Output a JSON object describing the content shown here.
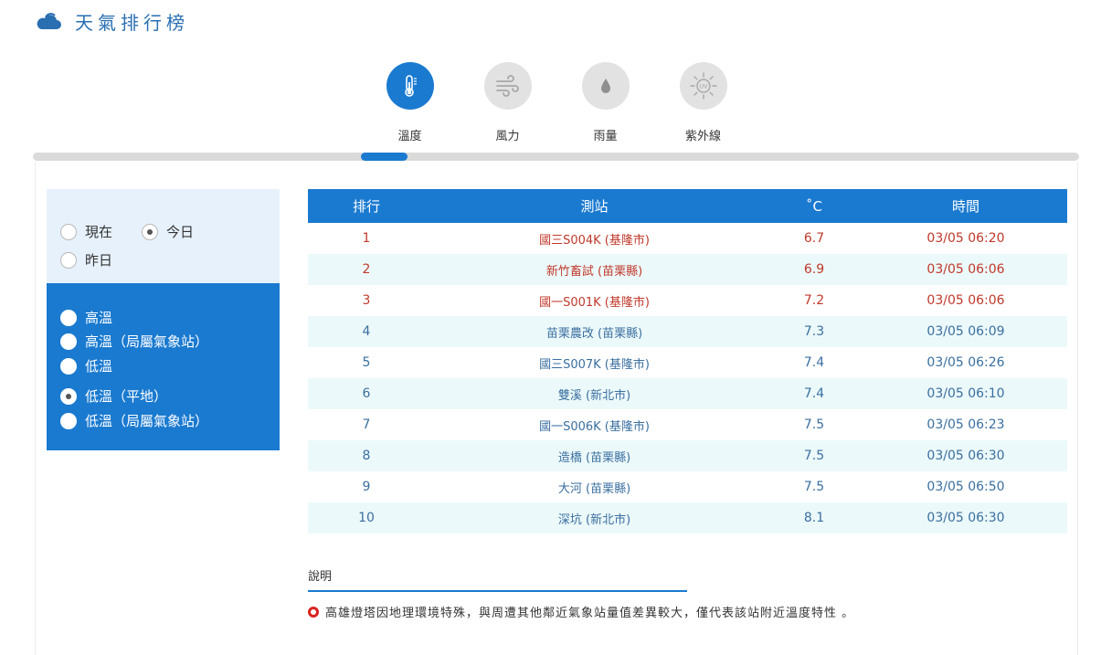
{
  "header": {
    "title": "天氣排行榜",
    "icon": "cloud-icon"
  },
  "tabs": [
    {
      "label": "溫度",
      "icon": "thermometer-icon",
      "active": true
    },
    {
      "label": "風力",
      "icon": "wind-icon",
      "active": false
    },
    {
      "label": "雨量",
      "icon": "raindrop-icon",
      "active": false
    },
    {
      "label": "紫外線",
      "icon": "uv-sun-icon",
      "active": false
    }
  ],
  "time_filter": {
    "options": [
      {
        "label": "現在",
        "checked": false
      },
      {
        "label": "今日",
        "checked": true
      },
      {
        "label": "昨日",
        "checked": false
      }
    ]
  },
  "type_filter": {
    "options": [
      {
        "label": "高溫",
        "checked": false
      },
      {
        "label": "高溫（局屬氣象站）",
        "checked": false
      },
      {
        "label": "低溫",
        "checked": false
      },
      {
        "label": "低溫（平地）",
        "checked": true
      },
      {
        "label": "低溫（局屬氣象站）",
        "checked": false
      }
    ]
  },
  "table": {
    "headers": {
      "rank": "排行",
      "station": "測站",
      "temp": "˚C",
      "time": "時間"
    },
    "rows": [
      {
        "rank": "1",
        "station": "國三S004K (基隆市)",
        "temp": "6.7",
        "time": "03/05 06:20",
        "highlight": true
      },
      {
        "rank": "2",
        "station": "新竹畜試 (苗栗縣)",
        "temp": "6.9",
        "time": "03/05 06:06",
        "highlight": true
      },
      {
        "rank": "3",
        "station": "國一S001K (基隆市)",
        "temp": "7.2",
        "time": "03/05 06:06",
        "highlight": true
      },
      {
        "rank": "4",
        "station": "苗栗農改 (苗栗縣)",
        "temp": "7.3",
        "time": "03/05 06:09",
        "highlight": false
      },
      {
        "rank": "5",
        "station": "國三S007K (基隆市)",
        "temp": "7.4",
        "time": "03/05 06:26",
        "highlight": false
      },
      {
        "rank": "6",
        "station": "雙溪 (新北市)",
        "temp": "7.4",
        "time": "03/05 06:10",
        "highlight": false
      },
      {
        "rank": "7",
        "station": "國一S006K (基隆市)",
        "temp": "7.5",
        "time": "03/05 06:23",
        "highlight": false
      },
      {
        "rank": "8",
        "station": "造橋 (苗栗縣)",
        "temp": "7.5",
        "time": "03/05 06:30",
        "highlight": false
      },
      {
        "rank": "9",
        "station": "大河 (苗栗縣)",
        "temp": "7.5",
        "time": "03/05 06:50",
        "highlight": false
      },
      {
        "rank": "10",
        "station": "深坑 (新北市)",
        "temp": "8.1",
        "time": "03/05 06:30",
        "highlight": false
      }
    ]
  },
  "notes": {
    "title": "說明",
    "items": [
      "高雄燈塔因地理環境特殊，與周遭其他鄰近氣象站量值差異較大，僅代表該站附近溫度特性 。"
    ]
  },
  "colors": {
    "accent": "#1a7ad0",
    "highlight_text": "#c0392b",
    "row_alt": "#ecf9fa"
  }
}
